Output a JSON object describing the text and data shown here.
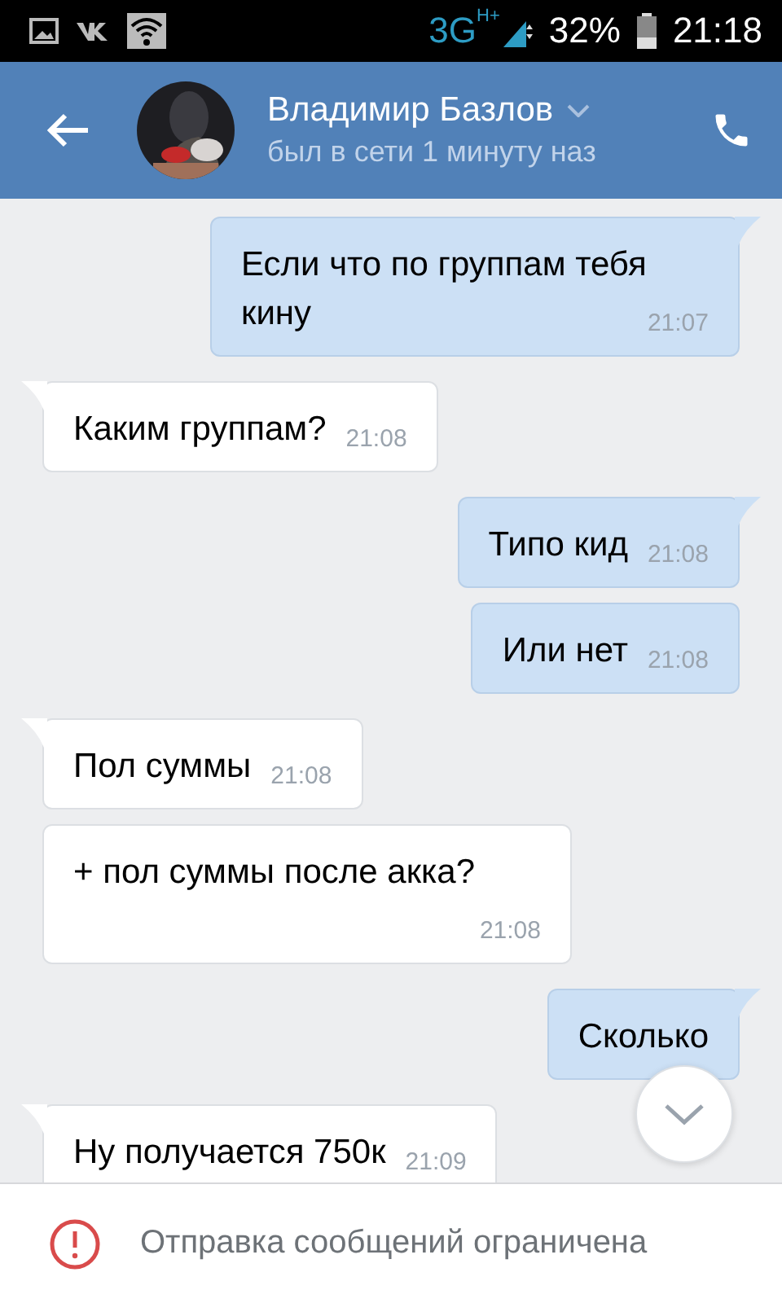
{
  "status_bar": {
    "network": "3G",
    "network_sub": "H+",
    "battery": "32%",
    "time": "21:18"
  },
  "header": {
    "name": "Владимир Базлов",
    "status": "был в сети 1 минуту наз"
  },
  "messages": [
    {
      "kind": "outgoing",
      "text": "Если что по группам тебя кину",
      "time": "21:07"
    },
    {
      "kind": "incoming",
      "text": "Каким группам?",
      "time": "21:08"
    },
    {
      "kind": "outgoing",
      "text": "Типо кид",
      "time": "21:08"
    },
    {
      "kind": "outgoing",
      "text": "Или нет",
      "time": "21:08"
    },
    {
      "kind": "incoming",
      "text": "Пол суммы",
      "time": "21:08"
    },
    {
      "kind": "incoming",
      "text": "+ пол суммы после акка?",
      "time": "21:08"
    },
    {
      "kind": "outgoing",
      "text": "Сколько"
    },
    {
      "kind": "incoming",
      "text": "Ну получается 750к",
      "time": "21:09"
    }
  ],
  "footer": {
    "notice": "Отправка сообщений ограничена"
  }
}
